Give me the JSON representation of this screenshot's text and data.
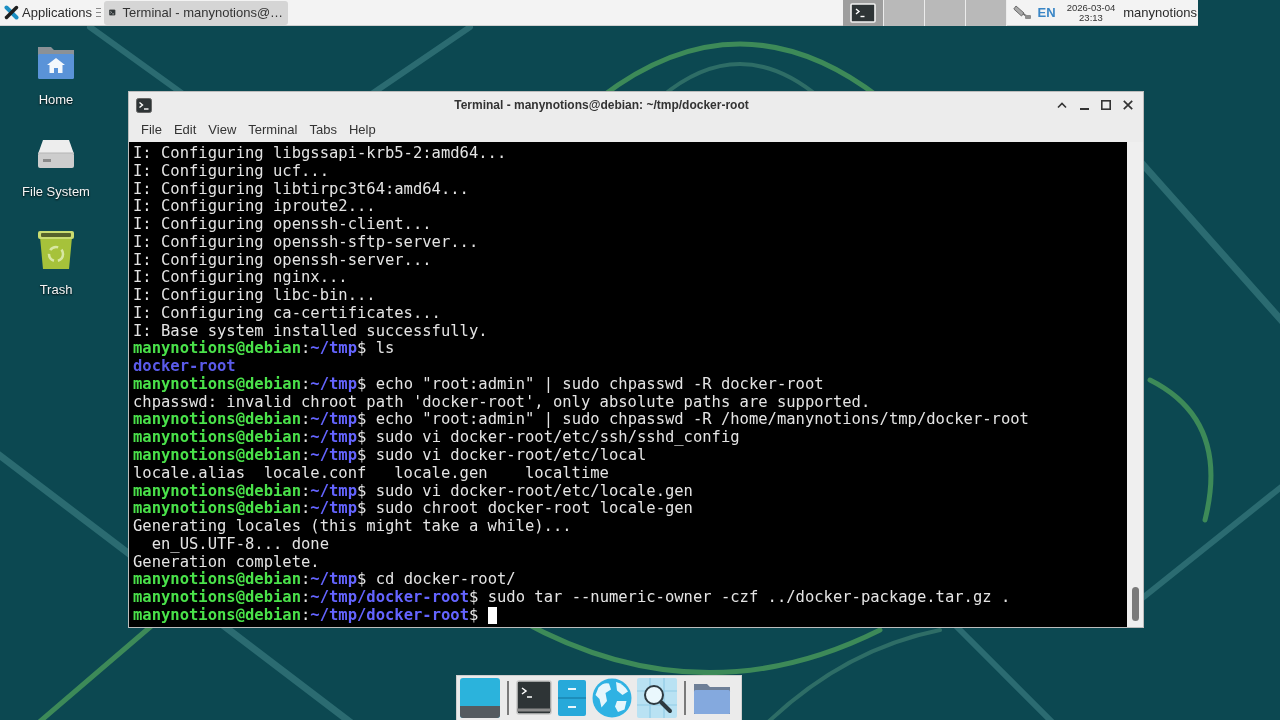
{
  "top_panel": {
    "menu_label": "Applications",
    "tasks": [
      {
        "title": "Terminal - manynotions@…",
        "selected": true
      }
    ],
    "workspaces": [
      {
        "selected": true,
        "shows_window": true
      },
      {
        "selected": false,
        "shows_window": false
      },
      {
        "selected": false,
        "shows_window": false
      },
      {
        "selected": false,
        "shows_window": false
      }
    ],
    "keyboard_layout": "EN",
    "date": "2026-03-04",
    "time": "23:13",
    "user": "manynotions"
  },
  "desktop_icons": [
    {
      "kind": "home",
      "label": "Home"
    },
    {
      "kind": "drive",
      "label": "File System"
    },
    {
      "kind": "trash",
      "label": "Trash"
    }
  ],
  "window": {
    "title": "Terminal - manynotions@debian: ~/tmp/docker-root",
    "menu": [
      "File",
      "Edit",
      "View",
      "Terminal",
      "Tabs",
      "Help"
    ],
    "terminal": {
      "cursor": true,
      "lines": [
        {
          "kind": "output",
          "text": "I: Configuring libgssapi-krb5-2:amd64..."
        },
        {
          "kind": "output",
          "text": "I: Configuring ucf..."
        },
        {
          "kind": "output",
          "text": "I: Configuring libtirpc3t64:amd64..."
        },
        {
          "kind": "output",
          "text": "I: Configuring iproute2..."
        },
        {
          "kind": "output",
          "text": "I: Configuring openssh-client..."
        },
        {
          "kind": "output",
          "text": "I: Configuring openssh-sftp-server..."
        },
        {
          "kind": "output",
          "text": "I: Configuring openssh-server..."
        },
        {
          "kind": "output",
          "text": "I: Configuring nginx..."
        },
        {
          "kind": "output",
          "text": "I: Configuring libc-bin..."
        },
        {
          "kind": "output",
          "text": "I: Configuring ca-certificates..."
        },
        {
          "kind": "output",
          "text": "I: Base system installed successfully."
        },
        {
          "kind": "prompt",
          "host": "manynotions@debian",
          "separator": ":",
          "path": "~/tmp",
          "sign": "$",
          "command": "ls"
        },
        {
          "kind": "dir",
          "text": "docker-root"
        },
        {
          "kind": "prompt",
          "host": "manynotions@debian",
          "separator": ":",
          "path": "~/tmp",
          "sign": "$",
          "command": "echo \"root:admin\" | sudo chpasswd -R docker-root"
        },
        {
          "kind": "output",
          "text": "chpasswd: invalid chroot path 'docker-root', only absolute paths are supported."
        },
        {
          "kind": "prompt",
          "host": "manynotions@debian",
          "separator": ":",
          "path": "~/tmp",
          "sign": "$",
          "command": "echo \"root:admin\" | sudo chpasswd -R /home/manynotions/tmp/docker-root"
        },
        {
          "kind": "prompt",
          "host": "manynotions@debian",
          "separator": ":",
          "path": "~/tmp",
          "sign": "$",
          "command": "sudo vi docker-root/etc/ssh/sshd_config"
        },
        {
          "kind": "prompt",
          "host": "manynotions@debian",
          "separator": ":",
          "path": "~/tmp",
          "sign": "$",
          "command": "sudo vi docker-root/etc/local"
        },
        {
          "kind": "output",
          "text": "locale.alias  locale.conf   locale.gen    localtime"
        },
        {
          "kind": "prompt",
          "host": "manynotions@debian",
          "separator": ":",
          "path": "~/tmp",
          "sign": "$",
          "command": "sudo vi docker-root/etc/locale.gen"
        },
        {
          "kind": "prompt",
          "host": "manynotions@debian",
          "separator": ":",
          "path": "~/tmp",
          "sign": "$",
          "command": "sudo chroot docker-root locale-gen"
        },
        {
          "kind": "output",
          "text": "Generating locales (this might take a while)..."
        },
        {
          "kind": "output",
          "text": "  en_US.UTF-8... done"
        },
        {
          "kind": "output",
          "text": "Generation complete."
        },
        {
          "kind": "prompt",
          "host": "manynotions@debian",
          "separator": ":",
          "path": "~/tmp",
          "sign": "$",
          "command": "cd docker-root/"
        },
        {
          "kind": "prompt",
          "host": "manynotions@debian",
          "separator": ":",
          "path": "~/tmp/docker-root",
          "sign": "$",
          "command": "sudo tar --numeric-owner -czf ../docker-package.tar.gz ."
        },
        {
          "kind": "prompt",
          "host": "manynotions@debian",
          "separator": ":",
          "path": "~/tmp/docker-root",
          "sign": "$"
        }
      ]
    }
  }
}
